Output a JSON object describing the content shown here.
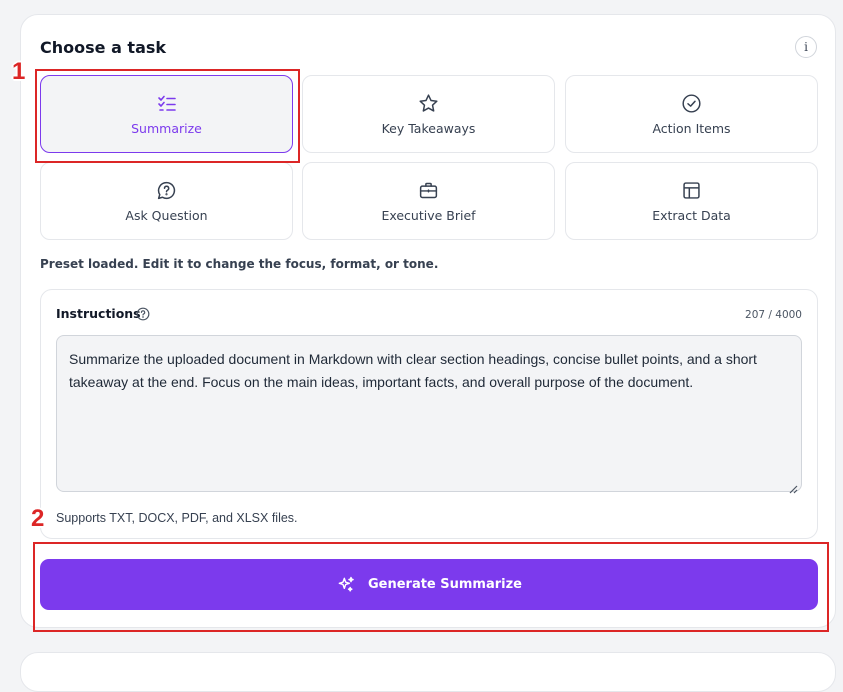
{
  "header": {
    "title": "Choose a task",
    "info_label": "i"
  },
  "tasks": [
    {
      "label": "Summarize",
      "icon": "list-check-icon",
      "active": true
    },
    {
      "label": "Key Takeaways",
      "icon": "star-icon",
      "active": false
    },
    {
      "label": "Action Items",
      "icon": "check-circle-icon",
      "active": false
    },
    {
      "label": "Ask Question",
      "icon": "question-bubble-icon",
      "active": false
    },
    {
      "label": "Executive Brief",
      "icon": "briefcase-icon",
      "active": false
    },
    {
      "label": "Extract Data",
      "icon": "table-icon",
      "active": false
    }
  ],
  "preset_hint": "Preset loaded. Edit it to change the focus, format, or tone.",
  "instructions": {
    "label": "Instructions",
    "counter": "207 / 4000",
    "value": "Summarize the uploaded document in Markdown with clear section headings, concise bullet points, and a short takeaway at the end. Focus on the main ideas, important facts, and overall purpose of the document."
  },
  "supports_text": "Supports TXT, DOCX, PDF, and XLSX files.",
  "generate_button": {
    "label": "Generate Summarize"
  },
  "annotations": [
    "1",
    "2"
  ],
  "colors": {
    "accent": "#7c3aed",
    "annotation": "#dc2626"
  }
}
